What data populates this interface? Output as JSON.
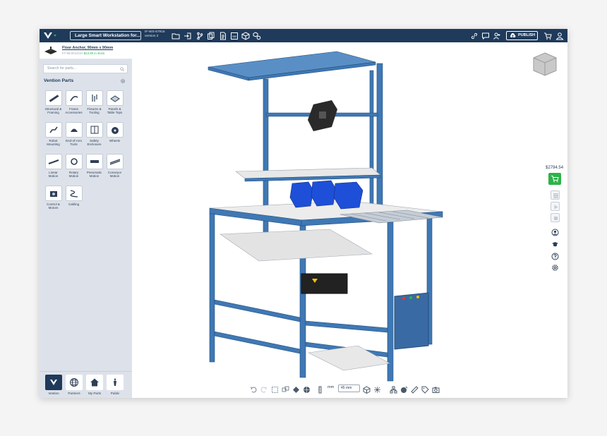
{
  "app": {
    "design_title": "Large Smart Workstation for...",
    "design_id": "IF-WS-67915",
    "design_version": "version 2",
    "publish_label": "PUBLISH"
  },
  "toolbar_icons": [
    "folder-icon",
    "import-icon",
    "branch-icon",
    "copy-icon",
    "document-icon",
    "bom-icon",
    "package-icon",
    "settings-cubes-icon"
  ],
  "right_icons": [
    "link-icon",
    "comment-icon",
    "user-add-icon",
    "cart-icon",
    "user-icon"
  ],
  "selected_part": {
    "name": "Floor Anchor, 90mm x 90mm",
    "part_code": "FT-08-0014/1H",
    "price_stock": "$13.90 in stock"
  },
  "search": {
    "placeholder": "Search for parts..."
  },
  "parts": {
    "title": "Vention Parts",
    "categories": [
      {
        "label": "Structural & Framing",
        "icon": "structural-framing-icon"
      },
      {
        "label": "Frame Accessories",
        "icon": "frame-accessories-icon"
      },
      {
        "label": "Fixtures & Tooling",
        "icon": "fixtures-tooling-icon"
      },
      {
        "label": "Panels & Table Tops",
        "icon": "panels-icon"
      },
      {
        "label": "Robot Mounting",
        "icon": "robot-mounting-icon"
      },
      {
        "label": "End-of-Arm Tools",
        "icon": "eoat-icon"
      },
      {
        "label": "Safety Enclosure",
        "icon": "safety-enclosure-icon"
      },
      {
        "label": "Wheels",
        "icon": "wheels-icon"
      },
      {
        "label": "Linear Motion",
        "icon": "linear-motion-icon"
      },
      {
        "label": "Rotary Motion",
        "icon": "rotary-motion-icon"
      },
      {
        "label": "Pneumatic Motion",
        "icon": "pneumatic-motion-icon"
      },
      {
        "label": "Conveyor Motion",
        "icon": "conveyor-motion-icon"
      },
      {
        "label": "Control & Motors",
        "icon": "control-motors-icon"
      },
      {
        "label": "Cabling",
        "icon": "cabling-icon"
      }
    ]
  },
  "tabs": [
    {
      "label": "Vention",
      "active": true
    },
    {
      "label": "Partners",
      "active": false
    },
    {
      "label": "My Parts",
      "active": false
    },
    {
      "label": "Public",
      "active": false
    }
  ],
  "canvas": {
    "price": "$2794.54",
    "unit_label": "mm",
    "step_value": "45 mm"
  },
  "colors": {
    "navy": "#1f3a5a",
    "green": "#2cb34a",
    "frame_blue": "#3f78b4",
    "bin_blue": "#1e4fd8"
  }
}
